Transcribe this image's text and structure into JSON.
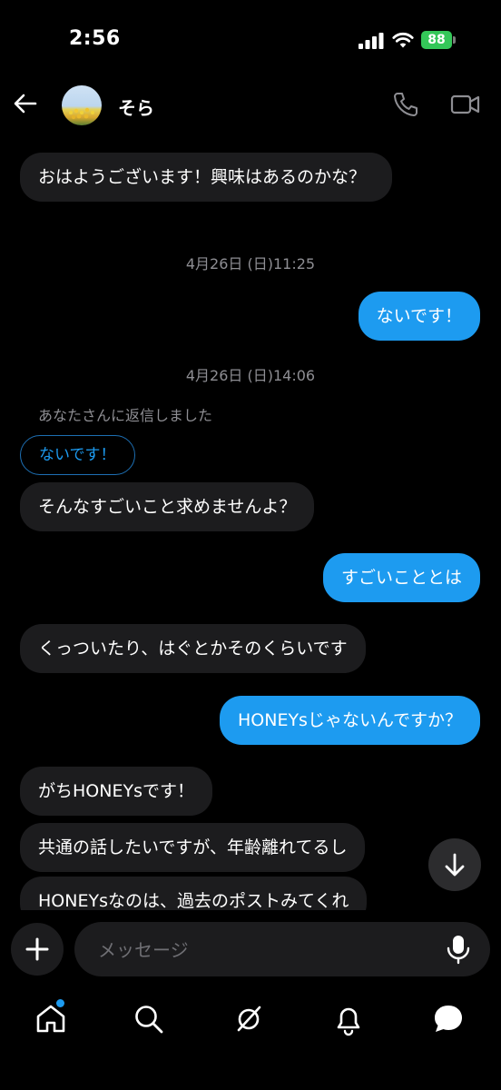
{
  "status_bar": {
    "time": "2:56",
    "battery": "88"
  },
  "header": {
    "contact_name": "そら"
  },
  "messages": [
    {
      "text": "おはようございます！興味はあるのかな？"
    },
    {
      "timestamp": "4月26日 (日)11:25"
    },
    {
      "text": "ないです！"
    },
    {
      "timestamp": "4月26日 (日)14:06"
    },
    {
      "reply_note": "あなたさんに返信しました",
      "quoted": "ないです！"
    },
    {
      "text": "そんなすごいこと求めませんよ？"
    },
    {
      "text": "すごいこととは"
    },
    {
      "text": "くっついたり、はぐとかそのくらいです"
    },
    {
      "text": "HONEYsじゃないんですか？"
    },
    {
      "text": "がちHONEYsです！"
    },
    {
      "text": "共通の話したいですが、年齢離れてるし"
    },
    {
      "text": "HONEYsなのは、過去のポストみてくれ"
    }
  ],
  "composer": {
    "placeholder": "メッセージ"
  },
  "colors": {
    "accent": "#1d9bf0",
    "incoming_bubble": "#1c1c1e",
    "background": "#000000"
  },
  "icons": {
    "back": "arrow-left-icon",
    "call": "phone-icon",
    "video": "video-camera-icon",
    "scroll": "arrow-down-icon",
    "add": "plus-icon",
    "mic": "microphone-icon",
    "tabs": [
      "home-icon",
      "search-icon",
      "grok-icon",
      "bell-icon",
      "chat-icon"
    ]
  }
}
